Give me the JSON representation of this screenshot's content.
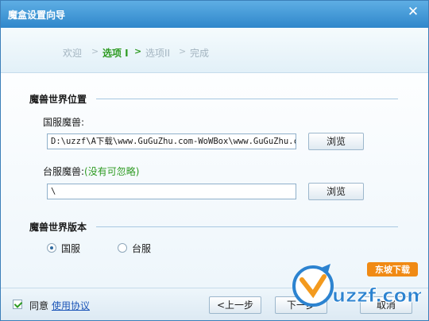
{
  "window": {
    "title": "魔盒设置向导"
  },
  "steps": [
    {
      "label": "欢迎",
      "state": "done"
    },
    {
      "label": "选项 I",
      "state": "active"
    },
    {
      "label": "选项II",
      "state": "pending"
    },
    {
      "label": "完成",
      "state": "pending"
    }
  ],
  "location": {
    "title": "魔兽世界位置",
    "cn_label": "国服魔兽:",
    "cn_path": "D:\\uzzf\\A下载\\www.GuGuZhu.com-WoWBox\\www.GuGuZhu.cc",
    "tw_label": "台服魔兽:",
    "tw_hint": "(没有可忽略)",
    "tw_path": "\\",
    "browse_label": "浏览"
  },
  "version": {
    "title": "魔兽世界版本",
    "options": [
      {
        "label": "国服",
        "selected": true
      },
      {
        "label": "台服",
        "selected": false
      }
    ]
  },
  "footer": {
    "agree_checked": true,
    "agree_label": "同意",
    "license_link": "使用协议",
    "prev_label": "<上一步",
    "next_label": "下一步",
    "cancel_label": "取消"
  },
  "watermark": {
    "text": "uzzf.com",
    "badge": "东坡下载"
  },
  "colors": {
    "titlebar": "#3a93d5",
    "accent_green": "#2d9a21",
    "link_blue": "#1d56b8"
  }
}
